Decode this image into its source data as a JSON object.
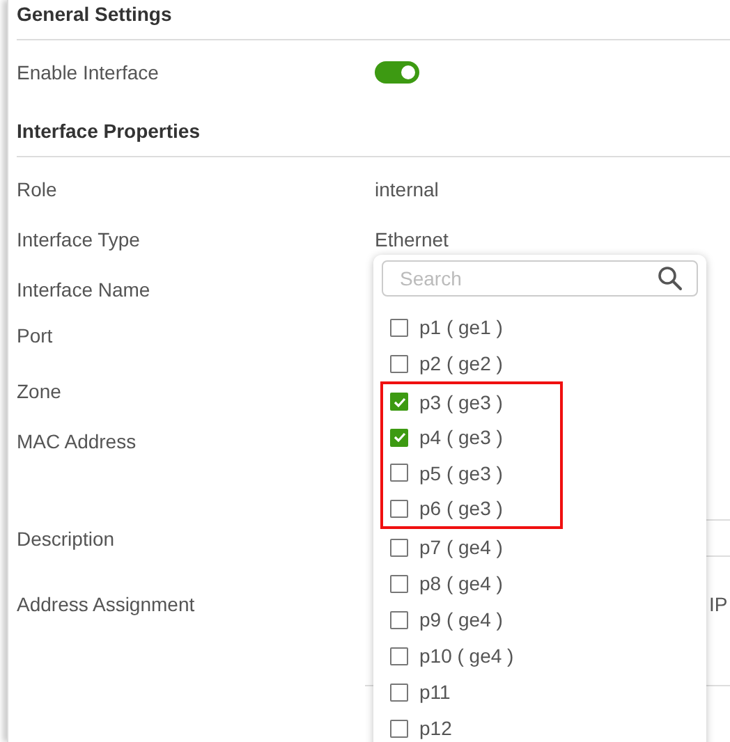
{
  "sections": [
    {
      "title": "General Settings",
      "fields": [
        {
          "kind": "toggle",
          "label": "Enable Interface",
          "on": true
        }
      ]
    },
    {
      "title": "Interface Properties",
      "fields": [
        {
          "kind": "text",
          "label": "Role",
          "value": "internal"
        },
        {
          "kind": "text",
          "label": "Interface Type",
          "value": "Ethernet"
        },
        {
          "kind": "text",
          "label": "Interface Name"
        },
        {
          "kind": "text",
          "label": "Port"
        },
        {
          "kind": "text",
          "label": "Zone"
        },
        {
          "kind": "text",
          "label": "MAC Address"
        },
        {
          "kind": "input",
          "label": "Description"
        },
        {
          "kind": "text",
          "label": "Address Assignment",
          "value_right": "IP"
        }
      ]
    }
  ],
  "port_dropdown": {
    "search": {
      "placeholder": "Search"
    },
    "options": [
      {
        "label": "p1 ( ge1 )",
        "checked": false,
        "highlighted": false
      },
      {
        "label": "p2 ( ge2 )",
        "checked": false,
        "highlighted": false
      },
      {
        "label": "p3 ( ge3 )",
        "checked": true,
        "highlighted": true
      },
      {
        "label": "p4 ( ge3 )",
        "checked": true,
        "highlighted": true
      },
      {
        "label": "p5 ( ge3 )",
        "checked": false,
        "highlighted": true
      },
      {
        "label": "p6 ( ge3 )",
        "checked": false,
        "highlighted": true
      },
      {
        "label": "p7 ( ge4 )",
        "checked": false,
        "highlighted": false
      },
      {
        "label": "p8 ( ge4 )",
        "checked": false,
        "highlighted": false
      },
      {
        "label": "p9 ( ge4 )",
        "checked": false,
        "highlighted": false
      },
      {
        "label": "p10 ( ge4 )",
        "checked": false,
        "highlighted": false
      },
      {
        "label": "p11",
        "checked": false,
        "highlighted": false
      },
      {
        "label": "p12",
        "checked": false,
        "highlighted": false
      }
    ]
  }
}
